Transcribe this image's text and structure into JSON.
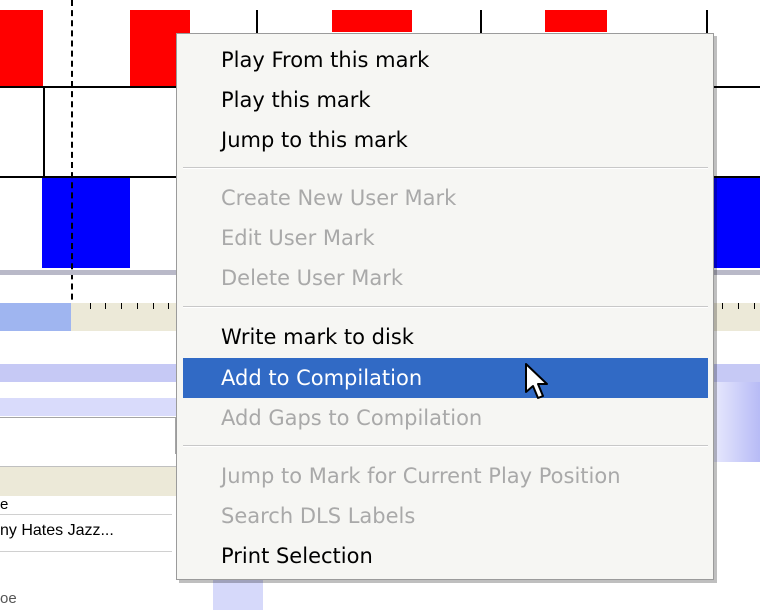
{
  "menu": {
    "items": [
      {
        "label": "Play From this mark",
        "enabled": true
      },
      {
        "label": "Play this mark",
        "enabled": true
      },
      {
        "label": "Jump to this mark",
        "enabled": true
      },
      {
        "label": "Create New User Mark",
        "enabled": false
      },
      {
        "label": "Edit User Mark",
        "enabled": false
      },
      {
        "label": "Delete User Mark",
        "enabled": false
      },
      {
        "label": "Write mark to disk",
        "enabled": true
      },
      {
        "label": "Add to Compilation",
        "enabled": true,
        "highlighted": true
      },
      {
        "label": "Add Gaps to Compilation",
        "enabled": false
      },
      {
        "label": "Jump to Mark for Current Play Position",
        "enabled": false
      },
      {
        "label": "Search DLS Labels",
        "enabled": false
      },
      {
        "label": "Print Selection",
        "enabled": true
      }
    ]
  },
  "background": {
    "list_header_partial": "e",
    "list_row_partial": "ny Hates Jazz...",
    "bottom_partial": "oe"
  },
  "colors": {
    "mark_red": "#ff0000",
    "mark_blue": "#0000ff",
    "menu_highlight": "#316ac5",
    "disabled_text": "#a9a9a9"
  }
}
